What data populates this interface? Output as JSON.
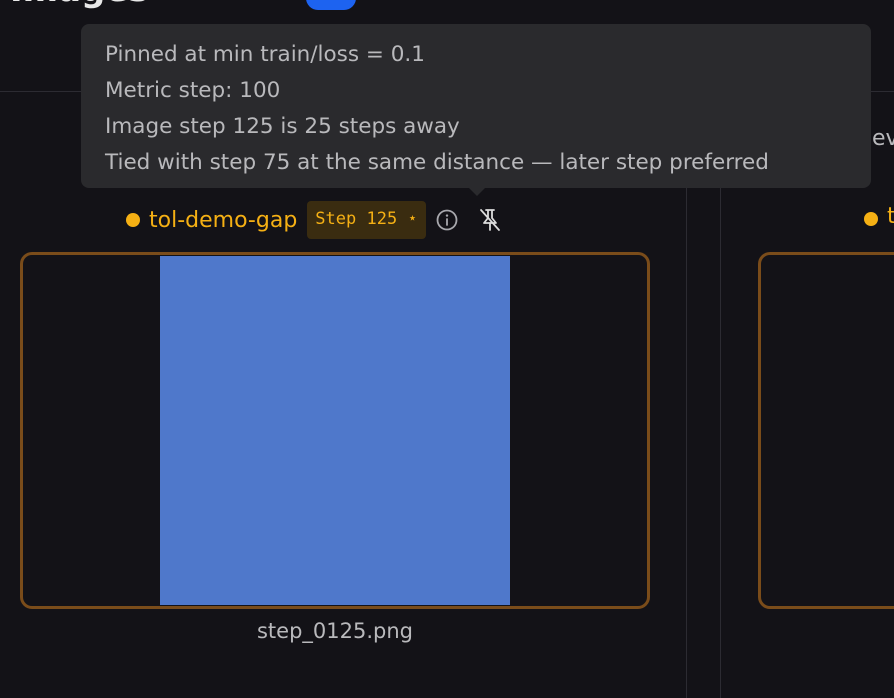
{
  "header": {
    "title": "Images"
  },
  "tooltip": {
    "lines": [
      "Pinned at min train/loss = 0.1",
      "Metric step: 100",
      "Image step 125 is 25 steps away",
      "Tied with step 75 at the same distance — later step preferred"
    ]
  },
  "card": {
    "run_name": "tol-demo-gap",
    "run_color": "#f5b014",
    "step_badge": "Step 125 ⋆",
    "info_icon": "info-icon",
    "pin_icon": "pin-off-icon",
    "image_color": "#4f78cb",
    "caption": "step_0125.png"
  },
  "neighbor": {
    "run_name_initial": "t",
    "peek_text": "ev"
  },
  "colors": {
    "accent": "#f5b014",
    "frame_border": "#7a4c1a",
    "background": "#131217",
    "tooltip_bg": "#2a2a2d",
    "primary_badge": "#1d63f0"
  }
}
